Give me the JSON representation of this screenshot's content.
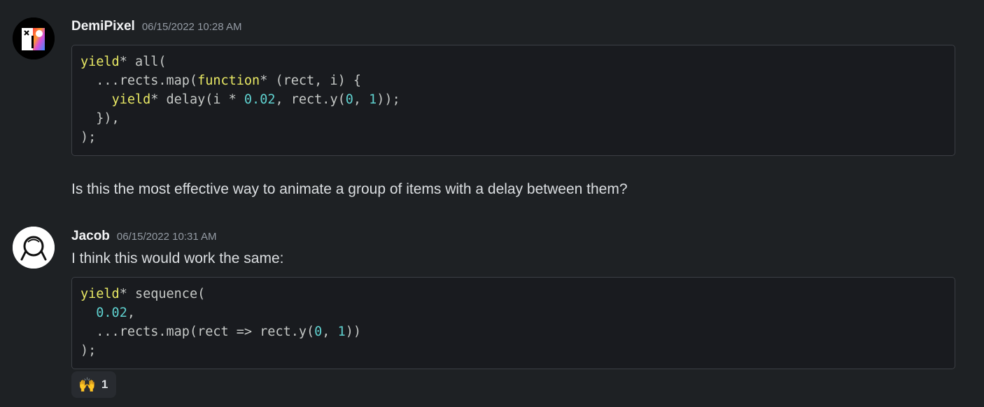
{
  "messages": [
    {
      "username": "DemiPixel",
      "timestamp": "06/15/2022 10:28 AM",
      "avatar_icon": "demipixel-avatar-icon",
      "code": [
        [
          {
            "t": "yield",
            "c": "kw"
          },
          {
            "t": "* all("
          }
        ],
        [
          {
            "t": "  ...rects.map("
          },
          {
            "t": "function",
            "c": "kw"
          },
          {
            "t": "* (rect, i) {"
          }
        ],
        [
          {
            "t": "    "
          },
          {
            "t": "yield",
            "c": "kw"
          },
          {
            "t": "* delay(i * "
          },
          {
            "t": "0.02",
            "c": "num"
          },
          {
            "t": ", rect.y("
          },
          {
            "t": "0",
            "c": "num"
          },
          {
            "t": ", "
          },
          {
            "t": "1",
            "c": "num"
          },
          {
            "t": "));"
          }
        ],
        [
          {
            "t": "  }),"
          }
        ],
        [
          {
            "t": ");"
          }
        ]
      ],
      "text": "Is this the most effective way to animate a group of items with a delay between them?"
    },
    {
      "username": "Jacob",
      "timestamp": "06/15/2022 10:31 AM",
      "avatar_icon": "jacob-avatar-icon",
      "text": "I think this would work the same:",
      "code": [
        [
          {
            "t": "yield",
            "c": "kw"
          },
          {
            "t": "* sequence("
          }
        ],
        [
          {
            "t": "  "
          },
          {
            "t": "0.02",
            "c": "num"
          },
          {
            "t": ","
          }
        ],
        [
          {
            "t": "  ...rects.map(rect => rect.y("
          },
          {
            "t": "0",
            "c": "num"
          },
          {
            "t": ", "
          },
          {
            "t": "1",
            "c": "num"
          },
          {
            "t": "))"
          }
        ],
        [
          {
            "t": ");"
          }
        ]
      ],
      "reaction": {
        "emoji": "🙌",
        "count": "1"
      }
    }
  ],
  "colors": {
    "background": "#1e2124",
    "code_background": "#191b1f",
    "keyword": "#e8e864",
    "number": "#5fd1cf"
  }
}
